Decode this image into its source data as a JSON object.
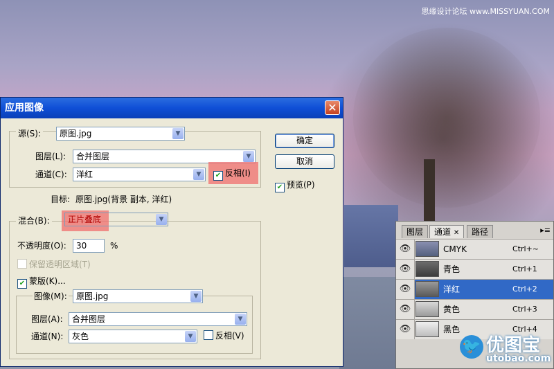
{
  "watermark": "思缘设计论坛 www.MISSYUAN.COM",
  "logo": {
    "cn": "优图宝",
    "en": "utobao.com"
  },
  "dialog": {
    "title": "应用图像",
    "source_label": "源(S):",
    "source_value": "原图.jpg",
    "layer_label": "图层(L):",
    "layer_value": "合并图层",
    "channel_label": "通道(C):",
    "channel_value": "洋红",
    "invert_label": "反相(I)",
    "target_label": "目标:",
    "target_value": "原图.jpg(背景 副本, 洋红)",
    "blend_label": "混合(B):",
    "blend_value": "正片叠底",
    "opacity_label": "不透明度(O):",
    "opacity_value": "30",
    "opacity_unit": "%",
    "preserve_label": "保留透明区域(T)",
    "mask_label": "蒙版(K)...",
    "mask_image_label": "图像(M):",
    "mask_image_value": "原图.jpg",
    "mask_layer_label": "图层(A):",
    "mask_layer_value": "合并图层",
    "mask_channel_label": "通道(N):",
    "mask_channel_value": "灰色",
    "mask_invert_label": "反相(V)",
    "ok_label": "确定",
    "cancel_label": "取消",
    "preview_label": "预览(P)"
  },
  "panel": {
    "tabs": [
      "图层",
      "通道",
      "路径"
    ],
    "channels": [
      {
        "name": "CMYK",
        "shortcut": "Ctrl+~"
      },
      {
        "name": "青色",
        "shortcut": "Ctrl+1"
      },
      {
        "name": "洋红",
        "shortcut": "Ctrl+2"
      },
      {
        "name": "黄色",
        "shortcut": "Ctrl+3"
      },
      {
        "name": "黑色",
        "shortcut": "Ctrl+4"
      }
    ]
  }
}
